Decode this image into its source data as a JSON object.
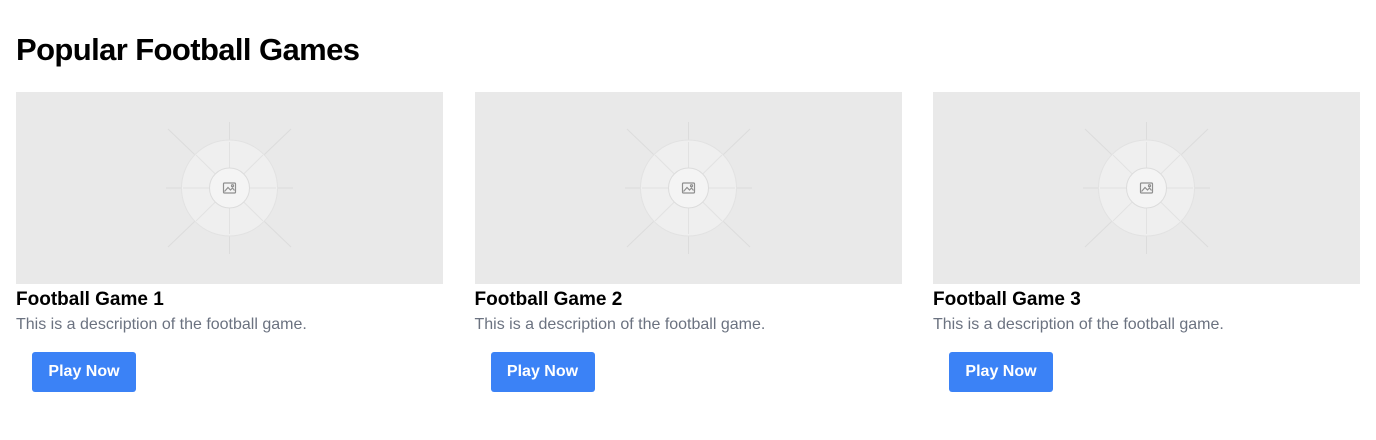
{
  "page": {
    "heading": "Popular Football Games"
  },
  "games": [
    {
      "title": "Football Game 1",
      "description": "This is a description of the football game.",
      "button_label": "Play Now",
      "image_icon": "image-placeholder-icon"
    },
    {
      "title": "Football Game 2",
      "description": "This is a description of the football game.",
      "button_label": "Play Now",
      "image_icon": "image-placeholder-icon"
    },
    {
      "title": "Football Game 3",
      "description": "This is a description of the football game.",
      "button_label": "Play Now",
      "image_icon": "image-placeholder-icon"
    }
  ],
  "colors": {
    "button_background": "#3b82f6",
    "button_text": "#ffffff",
    "description_text": "#6b7280",
    "placeholder_background": "#e9e9e9"
  }
}
